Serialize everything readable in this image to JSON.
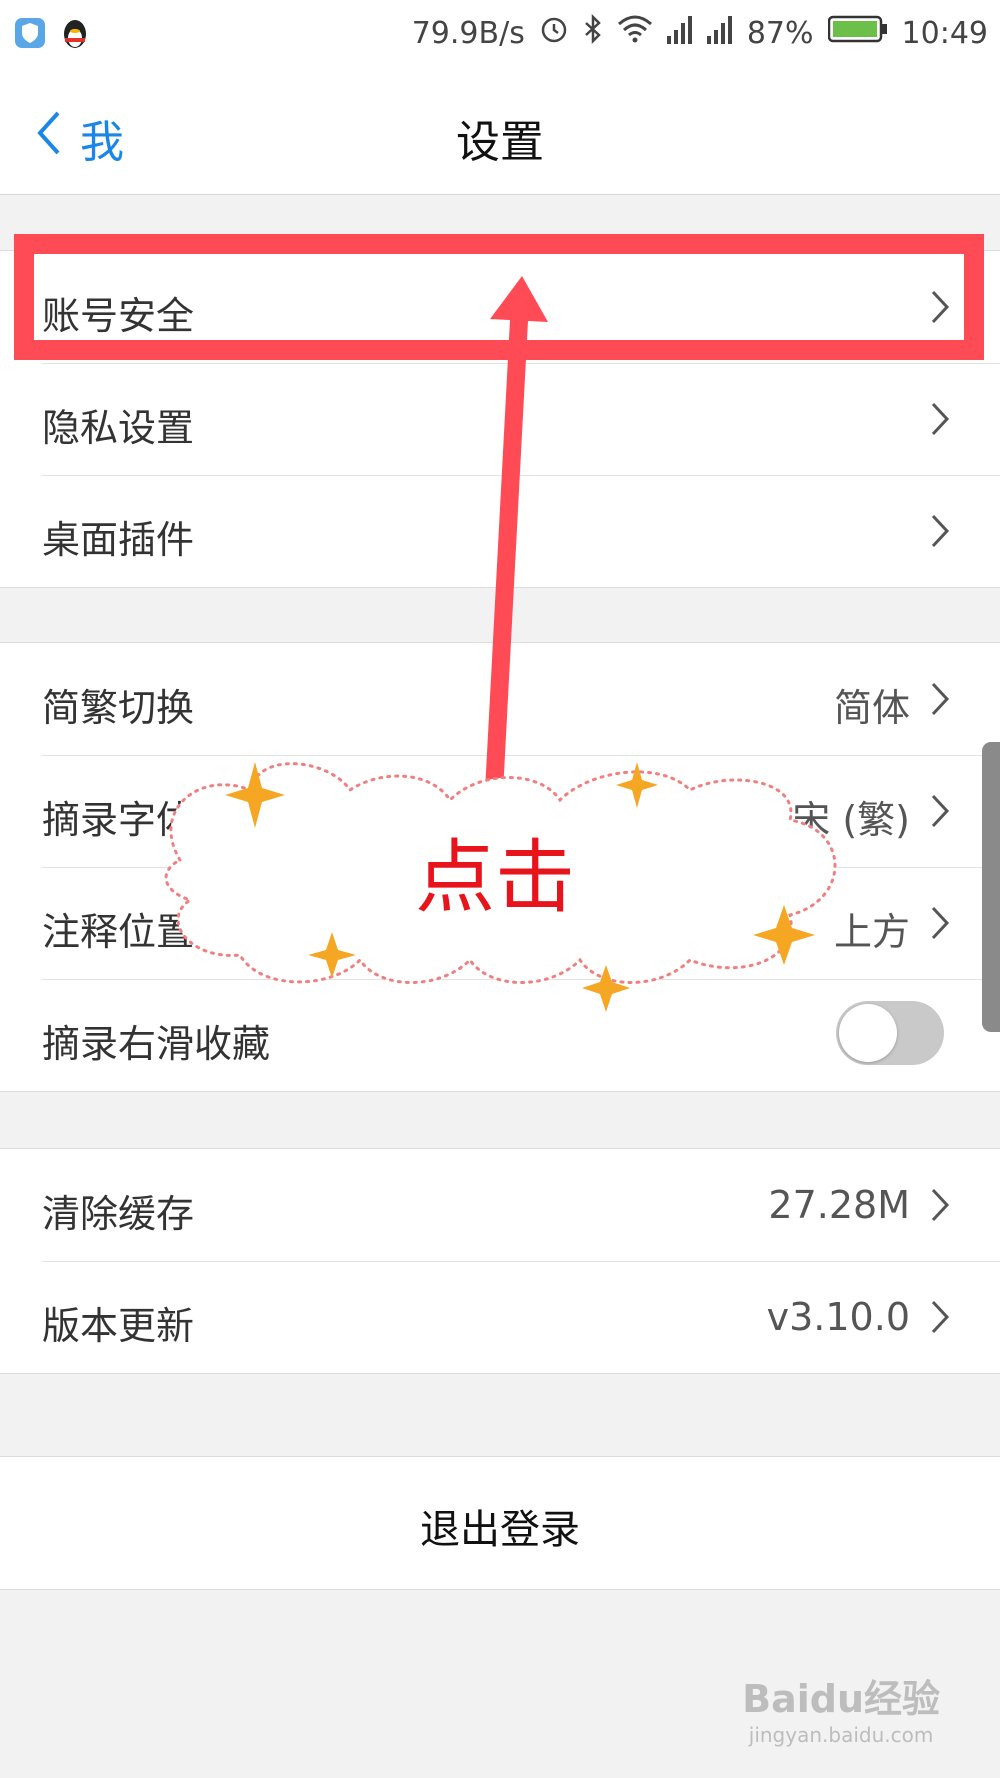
{
  "status_bar": {
    "net_speed": "79.9B/s",
    "battery": "87%",
    "time": "10:49",
    "icons": [
      "shield-app-icon",
      "qq-penguin-icon",
      "alarm-icon",
      "bluetooth-icon",
      "wifi-icon",
      "signal-icon",
      "signal-icon",
      "battery-icon"
    ]
  },
  "nav": {
    "back_label": "我",
    "title": "设置"
  },
  "groups": {
    "account": [
      {
        "label": "账号安全"
      },
      {
        "label": "隐私设置"
      },
      {
        "label": "桌面插件"
      }
    ],
    "display": [
      {
        "label": "简繁切换",
        "value": "简体"
      },
      {
        "label": "摘录字体",
        "value": "宋 (繁)"
      },
      {
        "label": "注释位置",
        "value": "上方"
      },
      {
        "label": "摘录右滑收藏",
        "toggle": false
      }
    ],
    "storage": [
      {
        "label": "清除缓存",
        "value": "27.28M"
      },
      {
        "label": "版本更新",
        "value": "v3.10.0"
      }
    ]
  },
  "logout_label": "退出登录",
  "annotation": {
    "text": "点击",
    "color": "#ff4b55",
    "text_color": "#e8141c"
  },
  "watermark": {
    "brand": "Baidu经验",
    "url": "jingyan.baidu.com"
  }
}
